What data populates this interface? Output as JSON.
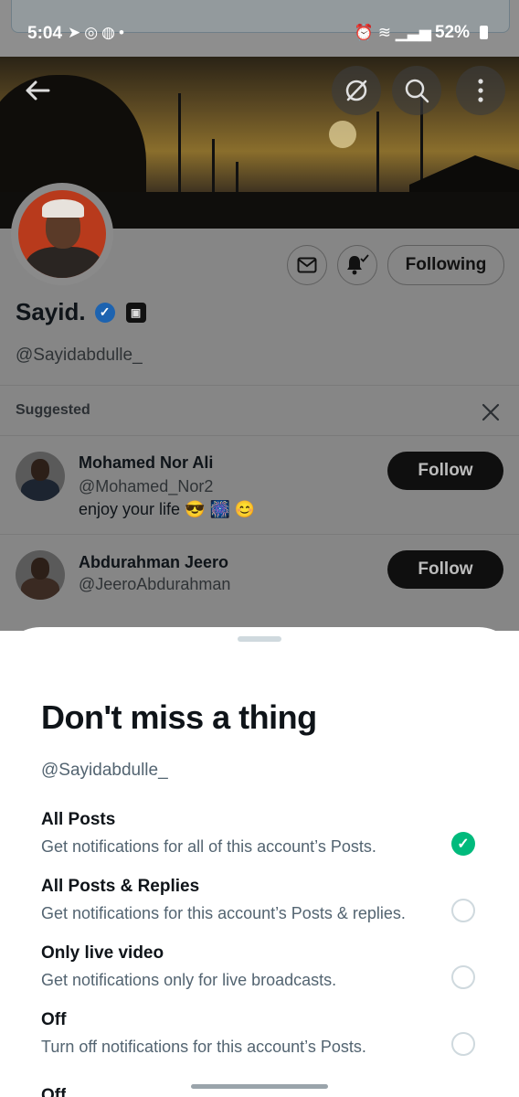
{
  "status_bar": {
    "time": "5:04",
    "left_icons": [
      "telegram-icon",
      "whatsapp-business-icon",
      "whatsapp-icon",
      "dot-icon"
    ],
    "right_icons": [
      "alarm-icon",
      "wifi-icon",
      "signal-icon"
    ],
    "battery": "52%"
  },
  "header": {
    "back_icon": "arrow-left-icon",
    "actions": [
      "grok-icon",
      "search-icon",
      "more-vertical-icon"
    ]
  },
  "profile": {
    "name": "Sayid.",
    "handle": "@Sayidabdulle_",
    "actions": [
      "mail-icon",
      "bell-check-icon"
    ],
    "following_label": "Following"
  },
  "suggested": {
    "title": "Suggested",
    "users": [
      {
        "name": "Mohamed Nor Ali",
        "handle": "@Mohamed_Nor2",
        "bio": "enjoy your life 😎 🎆 😊",
        "button": "Follow"
      },
      {
        "name": "Abdurahman Jeero",
        "handle": "@JeeroAbdurahman",
        "button": "Follow"
      }
    ]
  },
  "sheet": {
    "title": "Don't miss a thing",
    "handle": "@Sayidabdulle_",
    "options": [
      {
        "title": "All Posts",
        "desc": "Get notifications for all of this account’s Posts.",
        "selected": true
      },
      {
        "title": "All Posts & Replies",
        "desc": "Get notifications for this account’s Posts & replies.",
        "selected": false
      },
      {
        "title": "Only live video",
        "desc": "Get notifications only for live broadcasts.",
        "selected": false
      },
      {
        "title": "Off",
        "desc": "Turn off notifications for this account’s Posts.",
        "selected": false
      }
    ],
    "cut_label": "Off"
  },
  "colors": {
    "accent_green": "#00ba7c",
    "verified_blue": "#1d63b0"
  }
}
